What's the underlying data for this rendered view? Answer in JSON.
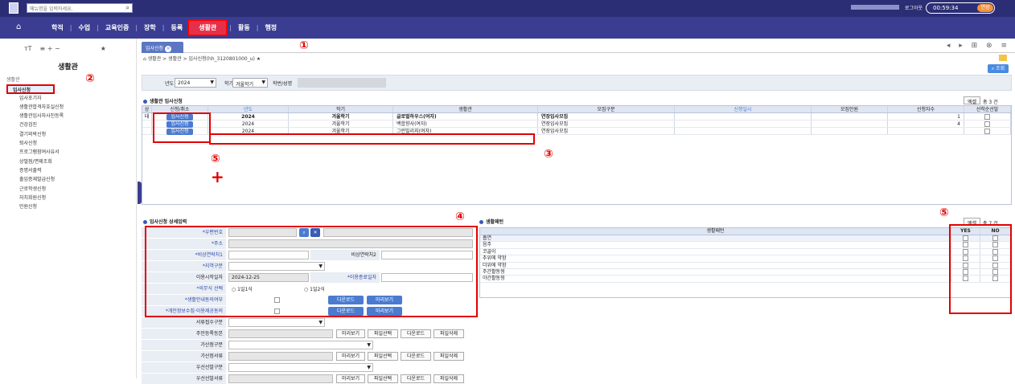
{
  "header": {
    "menu_search_placeholder": "메뉴명을 입력하세요.",
    "logout": "로그아웃",
    "timer": "00:59:34",
    "extend": "연장"
  },
  "nav": {
    "items": [
      "학적",
      "수업",
      "교육인증",
      "장학",
      "등록",
      "생활관",
      "활동",
      "행정"
    ],
    "active": "생활관"
  },
  "sidebar": {
    "title": "생활관",
    "root": "생활관",
    "items": [
      "입사신청",
      "입사포기자",
      "생활관합격자호실신청",
      "생활관입사자사진등록",
      "건강검진",
      "결기외박신청",
      "퇴사신청",
      "프로그램참여사유서",
      "상벌점/면제조회",
      "증명서출력",
      "출입증재발급신청",
      "근로학생신청",
      "자치회원신청",
      "민원신청"
    ]
  },
  "tab": {
    "label": "입사신청"
  },
  "breadcrumb": "생활관 > 생활관 > 입사신청(hh_3120801000_u)",
  "filter": {
    "year_label": "년도",
    "year_value": "2024",
    "term_label": "학기",
    "term_value": "겨울학기",
    "student_label": "학번/성명"
  },
  "search_button": "조회",
  "grid1": {
    "title": "생활관 입사신청",
    "excel": "엑셀",
    "count": "총 3 건",
    "columns": [
      "상태",
      "신청/취소",
      "년도",
      "학기",
      "생활관",
      "모집구분",
      "신청일시",
      "모집인원",
      "신청자수",
      "선착순선발"
    ],
    "rows": [
      {
        "btn": "입사신청",
        "year": "2024",
        "term": "겨울학기",
        "hall": "글로벌하우스(여자)",
        "type": "연장입사모집",
        "count": "1"
      },
      {
        "btn": "입사신청",
        "year": "2024",
        "term": "겨울학기",
        "hall": "백합향사(여자)",
        "type": "연장입사모집",
        "count": "4"
      },
      {
        "btn": "입사신청",
        "year": "2024",
        "term": "겨울학기",
        "hall": "그린빌리지(여자)",
        "type": "연장입사모집",
        "count": ""
      }
    ]
  },
  "form": {
    "title": "입사신청 상세입력",
    "postal": "*우편번호",
    "address": "*주소",
    "phone1": "*비상연락처1",
    "phone2": "비상연락처2",
    "region": "*지역구분",
    "start_label": "이용시작일자",
    "start_value": "2024-12-25",
    "end_label": "*이용종료일자",
    "meal_label": "*의무식 선택",
    "meal_opt1": "1일1식",
    "meal_opt2": "1일2식",
    "guide_label": "*생활안내동의여부",
    "privacy_label": "*개인정보수집·이용제공동의",
    "download": "다운로드",
    "preview": "미리보기",
    "doc_type": "서류접수구분",
    "resident": "주민등록등본",
    "file_select": "파일선택",
    "file_delete": "파일삭제",
    "bonus_type": "가산점구분",
    "bonus_doc": "가산점서류",
    "priority_type": "우선선발구분",
    "priority_doc": "우선선발서류"
  },
  "grid2": {
    "title": "생활패턴",
    "excel": "엑셀",
    "count": "총 7 건",
    "col_pattern": "생활패턴",
    "col_yes": "YES",
    "col_no": "NO",
    "rows": [
      "흡연",
      "음주",
      "코골이",
      "추위에 약함",
      "더위에 약함",
      "주간활동형",
      "야간활동형"
    ]
  },
  "annotations": [
    "①",
    "②",
    "③",
    "④",
    "⑤",
    "⑤"
  ]
}
